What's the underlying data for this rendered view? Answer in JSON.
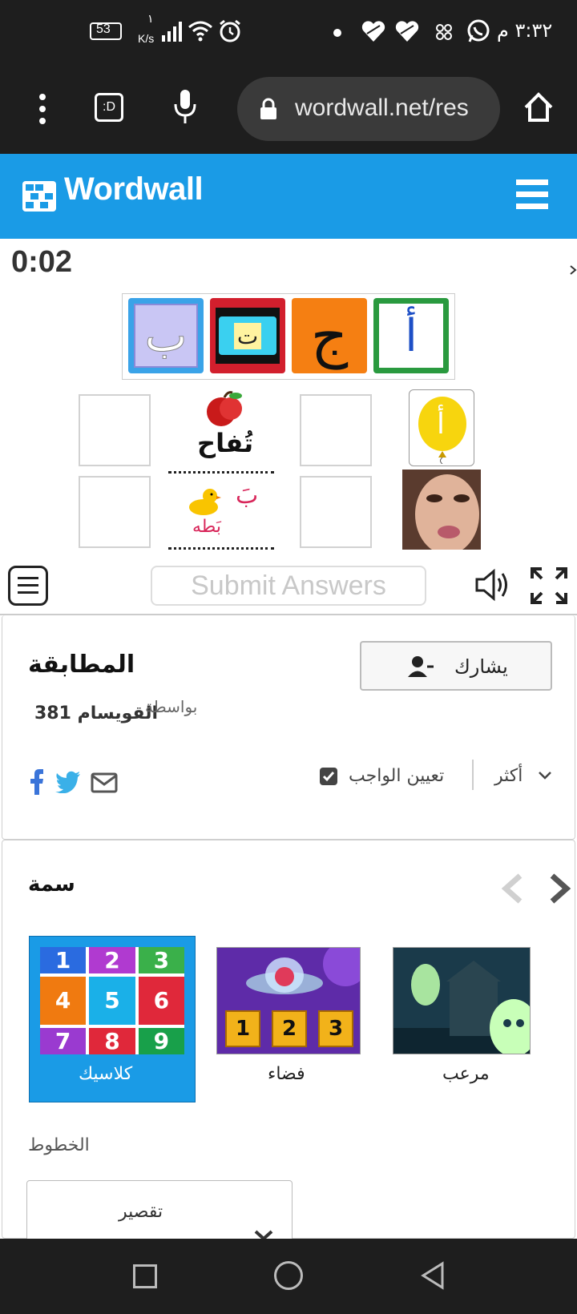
{
  "status_bar": {
    "time": "٣:٣٢ م",
    "battery": "53",
    "speed_top": "١",
    "speed_unit": "K/s"
  },
  "browser": {
    "url": "wordwall.net/res",
    "tab_count_icon": ":D"
  },
  "header": {
    "logo_text": "Wordwall"
  },
  "game": {
    "timer": "0:02",
    "tiles": [
      "أ",
      "ج",
      "ت",
      "ب"
    ],
    "fruit_word": "تُفاح",
    "duck_letter": "بَ",
    "duck_word": "بَطه",
    "submit_label": "Submit Answers"
  },
  "activity": {
    "title": "المطابقة",
    "by_label": "بواسطة",
    "author": "القويسام 381",
    "share_label": "يشارك",
    "more_label": "أكثر",
    "assign_label": "تعيين الواجب"
  },
  "theme_section": {
    "heading": "سمة",
    "themes": [
      {
        "label": "مرعب"
      },
      {
        "label": "فضاء"
      },
      {
        "label": "كلاسيك",
        "selected": true
      }
    ],
    "classic_numbers": [
      "1",
      "2",
      "3",
      "4",
      "5",
      "6",
      "7",
      "8",
      "9"
    ],
    "space_numbers": [
      "1",
      "2",
      "3"
    ],
    "fonts_label": "الخطوط",
    "font_select_value": "تقصير"
  },
  "colors": {
    "brand_blue": "#1a9be6",
    "selected_theme": "#1a9be6",
    "dark_bar": "#1e1e1e"
  }
}
